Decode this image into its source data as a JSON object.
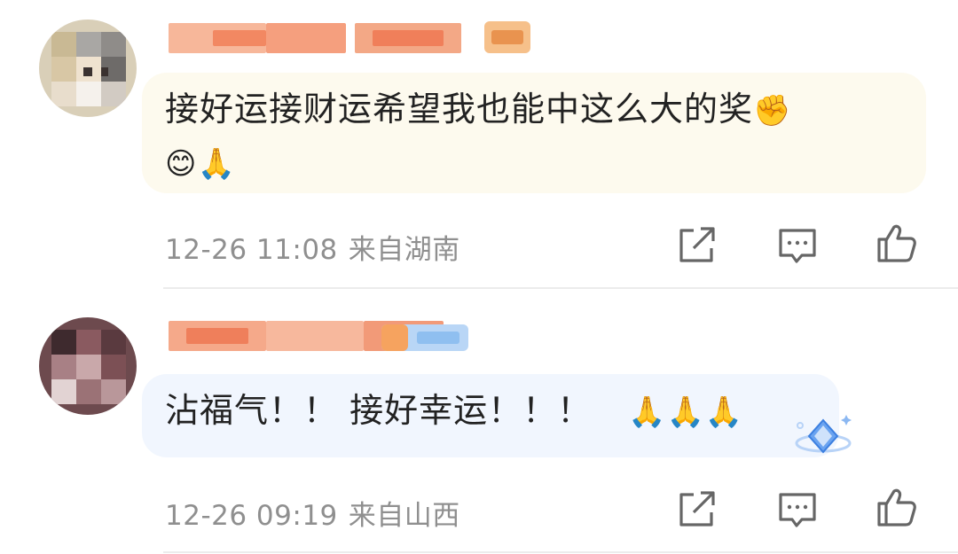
{
  "comments": [
    {
      "text": "接好运接财运希望我也能中这么大的奖",
      "emojis_inline": [
        "✊"
      ],
      "emojis_line2": [
        "😊",
        "🙏"
      ],
      "date": "12-26 11:08",
      "location": "来自湖南"
    },
    {
      "text": "沾福气！！ 接好幸运！！！",
      "emojis_inline": [
        "🙏",
        "🙏",
        "🙏"
      ],
      "date": "12-26 09:19",
      "location": "来自山西"
    }
  ],
  "icons": {
    "share": "share-icon",
    "reply": "comment-icon",
    "like": "thumbs-up-icon"
  },
  "colors": {
    "bubble1": "#fdfaee",
    "bubble2": "#f1f6fe",
    "meta": "#8f8f8f",
    "divider": "#ececec"
  }
}
